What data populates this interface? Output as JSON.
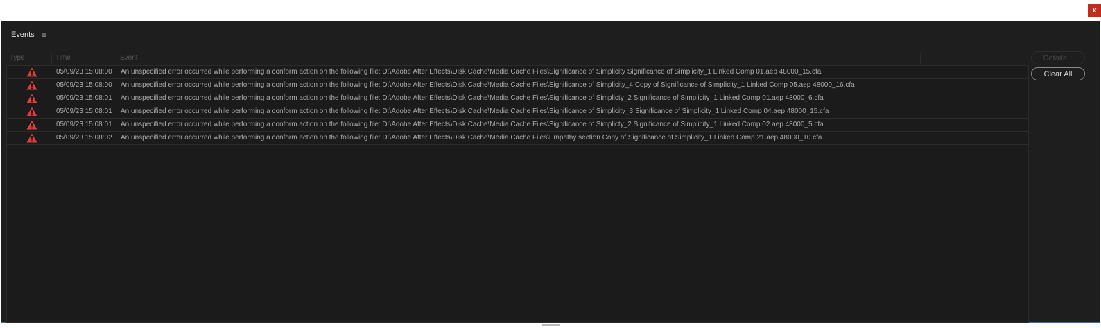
{
  "window": {
    "close_label": "x"
  },
  "panel": {
    "title": "Events",
    "menu_glyph": "≡"
  },
  "columns": {
    "type": "Type",
    "time": "Time",
    "event": "Event"
  },
  "buttons": {
    "details": "Details...",
    "clear_all": "Clear All"
  },
  "colors": {
    "error": "#e03c3c",
    "background": "#1e1e1e"
  },
  "events": [
    {
      "type_icon": "error-warning-icon",
      "time": "05/09/23 15:08:00",
      "event": "An unspecified error occurred while performing a conform action on the following file: D:\\Adobe After Effects\\Disk Cache\\Media Cache Files\\Significance of Simplicity Significance of Simplicity_1 Linked Comp 01.aep 48000_15.cfa"
    },
    {
      "type_icon": "error-warning-icon",
      "time": "05/09/23 15:08:00",
      "event": "An unspecified error occurred while performing a conform action on the following file: D:\\Adobe After Effects\\Disk Cache\\Media Cache Files\\Significance of Simplicity_4 Copy of Significance of Simplicity_1 Linked Comp 05.aep 48000_16.cfa"
    },
    {
      "type_icon": "error-warning-icon",
      "time": "05/09/23 15:08:01",
      "event": "An unspecified error occurred while performing a conform action on the following file: D:\\Adobe After Effects\\Disk Cache\\Media Cache Files\\Significance of Simplicty_2 Significance of Simplicity_1 Linked Comp 01.aep 48000_6.cfa"
    },
    {
      "type_icon": "error-warning-icon",
      "time": "05/09/23 15:08:01",
      "event": "An unspecified error occurred while performing a conform action on the following file: D:\\Adobe After Effects\\Disk Cache\\Media Cache Files\\Significance of Simplicity_3 Significance of Simplicity_1 Linked Comp 04.aep 48000_15.cfa"
    },
    {
      "type_icon": "error-warning-icon",
      "time": "05/09/23 15:08:01",
      "event": "An unspecified error occurred while performing a conform action on the following file: D:\\Adobe After Effects\\Disk Cache\\Media Cache Files\\Significance of Simplicty_2 Significance of Simplicity_1 Linked Comp 02.aep 48000_5.cfa"
    },
    {
      "type_icon": "error-warning-icon",
      "time": "05/09/23 15:08:02",
      "event": "An unspecified error occurred while performing a conform action on the following file: D:\\Adobe After Effects\\Disk Cache\\Media Cache Files\\Empathy section Copy of Significance of Simplicity_1 Linked Comp 21.aep 48000_10.cfa"
    }
  ]
}
